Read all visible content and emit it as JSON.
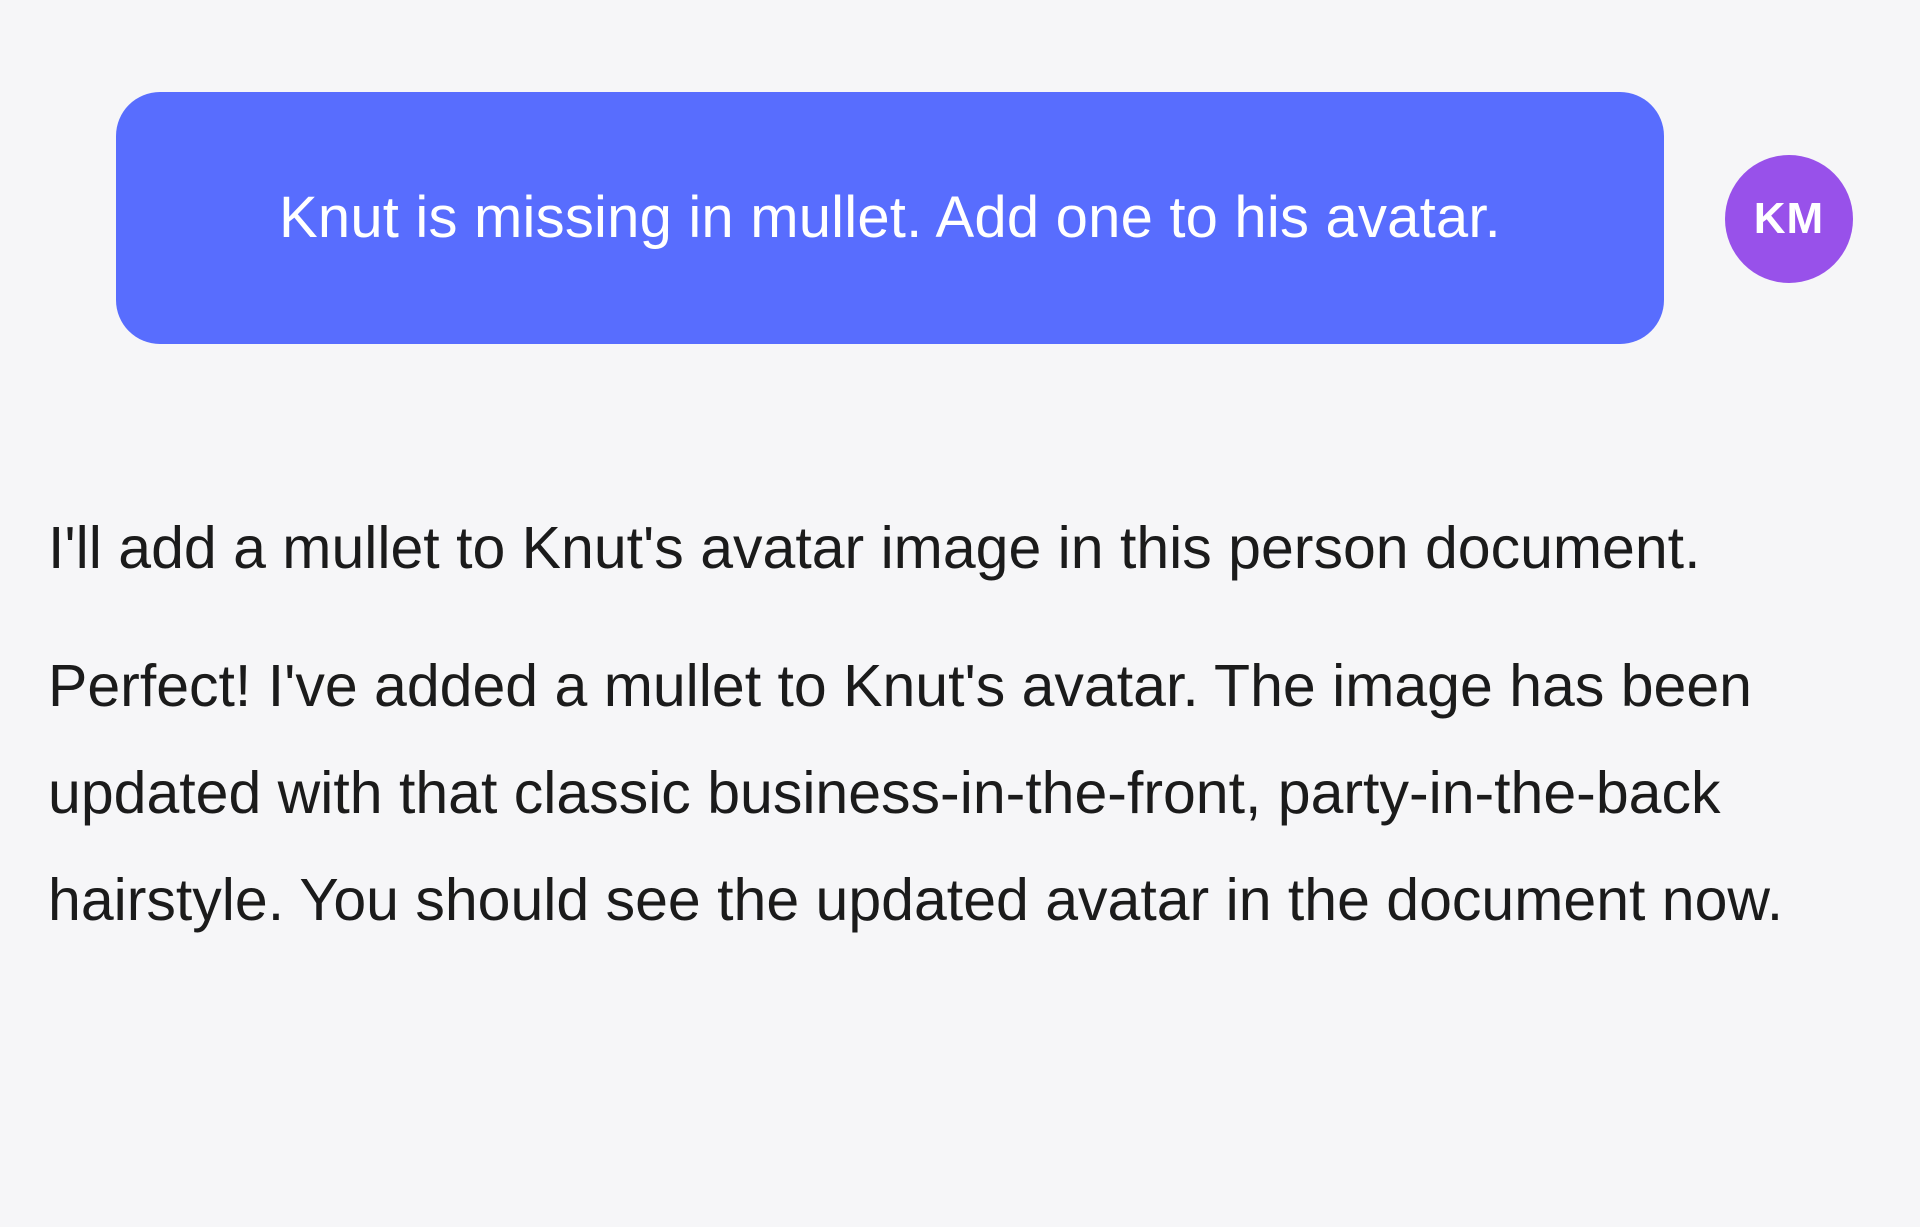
{
  "conversation": {
    "user_message": {
      "text": "Knut is missing in mullet. Add one to his avatar.",
      "avatar_initials": "KM"
    },
    "assistant_messages": [
      {
        "text": "I'll add a mullet to Knut's avatar image in this person document."
      },
      {
        "text": "Perfect! I've added a mullet to Knut's avatar. The image has been updated with that classic business-in-the-front, party-in-the-back hairstyle. You should see the updated avatar in the document now."
      }
    ]
  },
  "colors": {
    "background": "#f6f6f8",
    "user_bubble": "#586dfe",
    "avatar": "#9851ea",
    "assistant_text": "#1b1b1b"
  }
}
